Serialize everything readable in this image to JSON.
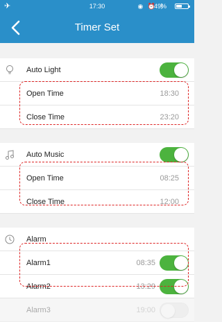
{
  "status_bar": {
    "time": "17:30",
    "battery_percent": "49%",
    "battery_level": 0.49,
    "icons": [
      "airplane-icon",
      "location-icon",
      "alarm-icon",
      "bluetooth-icon"
    ]
  },
  "nav": {
    "title": "Timer Set",
    "back_icon": "chevron-left-icon"
  },
  "colors": {
    "header": "#2a8fc9",
    "toggle_on": "#4cb33e",
    "highlight_dash": "#dd2222"
  },
  "sections": {
    "light": {
      "title": "Auto Light",
      "icon": "bulb-icon",
      "enabled": true,
      "open_label": "Open Time",
      "open_value": "18:30",
      "close_label": "Close Time",
      "close_value": "23:20"
    },
    "music": {
      "title": "Auto Music",
      "icon": "music-note-icon",
      "enabled": true,
      "open_label": "Open Time",
      "open_value": "08:25",
      "close_label": "Close Time",
      "close_value": "12:00"
    },
    "alarm": {
      "title": "Alarm",
      "icon": "clock-icon",
      "items": [
        {
          "label": "Alarm1",
          "time": "08:35",
          "enabled": true
        },
        {
          "label": "Alarm2",
          "time": "13:29",
          "enabled": true
        },
        {
          "label": "Alarm3",
          "time": "19:00",
          "enabled": false
        }
      ]
    }
  }
}
